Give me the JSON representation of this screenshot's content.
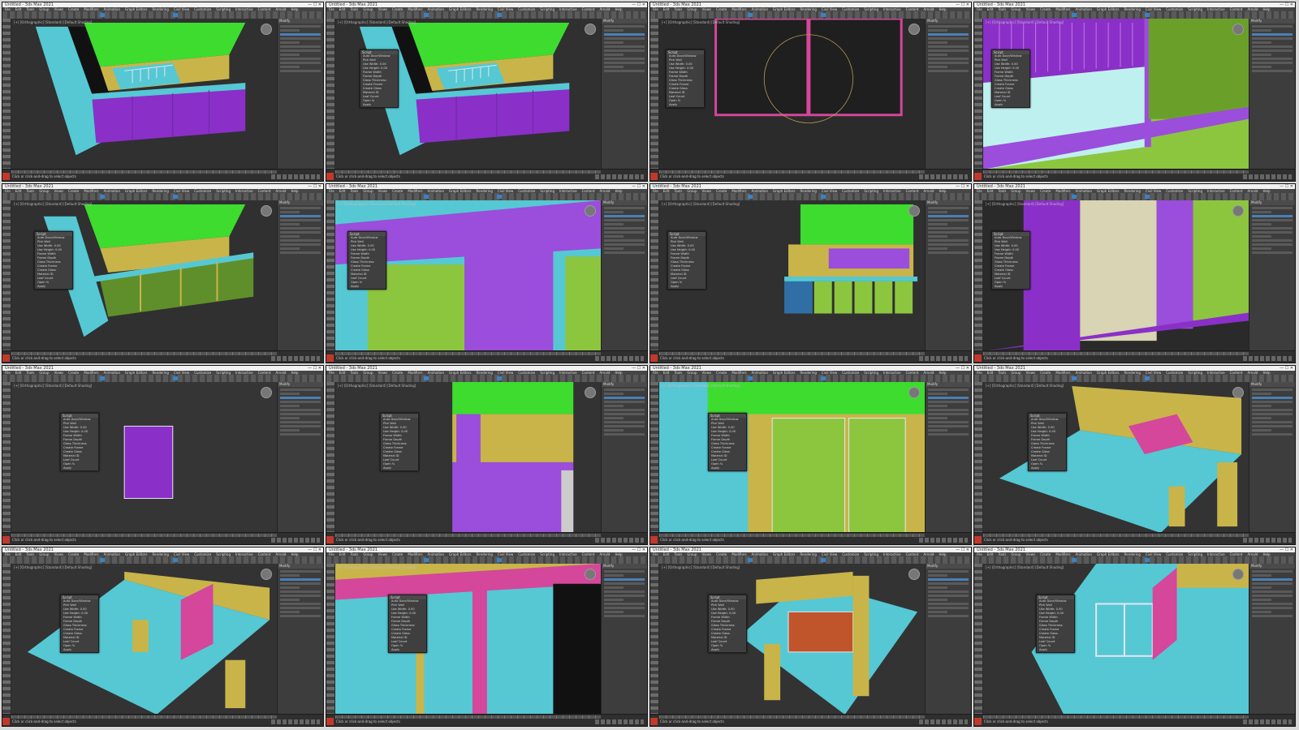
{
  "app": {
    "window_title": "Untitled - 3ds Max 2021",
    "window_buttons": "— ☐ ✕",
    "menu": [
      "File",
      "Edit",
      "Tools",
      "Group",
      "Views",
      "Create",
      "Modifiers",
      "Animation",
      "Graph Editors",
      "Rendering",
      "Civil View",
      "Customize",
      "Scripting",
      "Interactive",
      "Content",
      "Arnold",
      "Help"
    ],
    "viewport_label": "[+] [Orthographic] [Standard] [Default Shading]",
    "command_panel_title": "Modify",
    "float_dialog_title": "Script",
    "float_items": [
      "Auto Door/Window",
      "Pick Wall",
      "Use Width: 0.00",
      "Use Height: 0.00",
      "Frame Width",
      "Frame Depth",
      "Glass Thickness",
      "Create Frame",
      "Create Glass",
      "Material ID",
      "Leaf Count",
      "Open %",
      "Apply"
    ],
    "status_prompt": "Click or click-and-drag to select objects",
    "timeline_label": "0 / 100"
  },
  "colors": {
    "magenta_wall": "#8b2fc9",
    "violet_panel": "#9b4ddb",
    "roof_green": "#3ddc2f",
    "floor_cyan": "#55c8d4",
    "ochre_wall": "#c9b44a",
    "lime_panel": "#8cc63f",
    "pink_slab": "#d4479a",
    "frame_white": "#e6e6f0"
  },
  "tiles": [
    {
      "id": "t1",
      "scene": "building-iso-a",
      "has_dialog": false
    },
    {
      "id": "t2",
      "scene": "building-iso-b",
      "has_dialog": true
    },
    {
      "id": "t3",
      "scene": "frame-circle",
      "has_dialog": true
    },
    {
      "id": "t4",
      "scene": "interior-purple",
      "has_dialog": true
    },
    {
      "id": "t5",
      "scene": "building-iso-green",
      "has_dialog": true
    },
    {
      "id": "t6",
      "scene": "purple-closeup",
      "has_dialog": true
    },
    {
      "id": "t7",
      "scene": "front-elevation",
      "has_dialog": true
    },
    {
      "id": "t8",
      "scene": "purple-door",
      "has_dialog": true
    },
    {
      "id": "t9",
      "scene": "single-panel",
      "has_dialog": true
    },
    {
      "id": "t10",
      "scene": "facade-yellow",
      "has_dialog": true
    },
    {
      "id": "t11",
      "scene": "green-doors",
      "has_dialog": true
    },
    {
      "id": "t12",
      "scene": "yellow-room",
      "has_dialog": true
    },
    {
      "id": "t13",
      "scene": "room-pink-wall",
      "has_dialog": true
    },
    {
      "id": "t14",
      "scene": "pink-frame-closeup",
      "has_dialog": true
    },
    {
      "id": "t15",
      "scene": "room-red-doors",
      "has_dialog": true
    },
    {
      "id": "t16",
      "scene": "room-glass-doors",
      "has_dialog": true
    }
  ]
}
